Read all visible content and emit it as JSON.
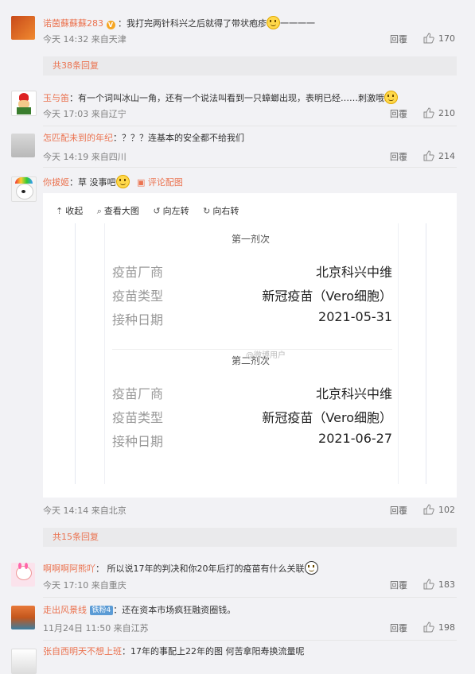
{
  "comments": [
    {
      "user": "诺茵蘇蘇蘇283",
      "text": "：我打完两针科兴之后就得了带状疱疹",
      "text_tail": "一一一一",
      "time": "今天 14:32 来自天津",
      "reply": "回覆",
      "likes": "170"
    },
    {
      "more": "共38条回复"
    },
    {
      "user": "玉与笛",
      "text": "：有一个词叫冰山一角，还有一个说法叫看到一只蟑螂出现，表明已经……刺激哦",
      "time": "今天 17:03 来自辽宁",
      "reply": "回覆",
      "likes": "210"
    },
    {
      "user": "怎匹配未到的年纪",
      "text": "：？？？连基本的安全都不给我们",
      "time": "今天 14:19 来自四川",
      "reply": "回覆",
      "likes": "214"
    },
    {
      "user": "你拔姬",
      "text": "：草 没事吧",
      "pic_link": "评论配图",
      "time": "今天 14:14 来自北京",
      "reply": "回覆",
      "likes": "102"
    },
    {
      "more": "共15条回复"
    },
    {
      "user": "啊啊啊阿熊吖",
      "text": "： 所以说17年的判决和你20年后打的疫苗有什么关联",
      "time": "今天 17:10 来自重庆",
      "reply": "回覆",
      "likes": "183"
    },
    {
      "user": "走出风景线",
      "badge": "铁粉4",
      "text": "：还在资本市场疯狂融资圈钱。",
      "time": "11月24日 11:50 来自江苏",
      "reply": "回覆",
      "likes": "198"
    },
    {
      "user": "张自西明天不想上班",
      "text": "：17年的事配上22年的图 何苦拿阳寿换流量呢"
    }
  ],
  "viewer": {
    "collapse": "收起",
    "view_large": "查看大图",
    "rotate_left": "向左转",
    "rotate_right": "向右转"
  },
  "vaccine_card": {
    "dose1_tab": "第一剂次",
    "dose2_tab": "第二剂次",
    "label_maker": "疫苗厂商",
    "label_type": "疫苗类型",
    "label_date": "接种日期",
    "dose1": {
      "maker": "北京科兴中维",
      "type": "新冠疫苗（Vero细胞）",
      "date": "2021-05-31"
    },
    "dose2": {
      "maker": "北京科兴中维",
      "type": "新冠疫苗（Vero细胞）",
      "date": "2021-06-27"
    },
    "watermark": "@微博用户"
  },
  "colors": {
    "username": "#eb7350",
    "background": "#f2f2f5",
    "more_bar": "#eaeaec"
  }
}
